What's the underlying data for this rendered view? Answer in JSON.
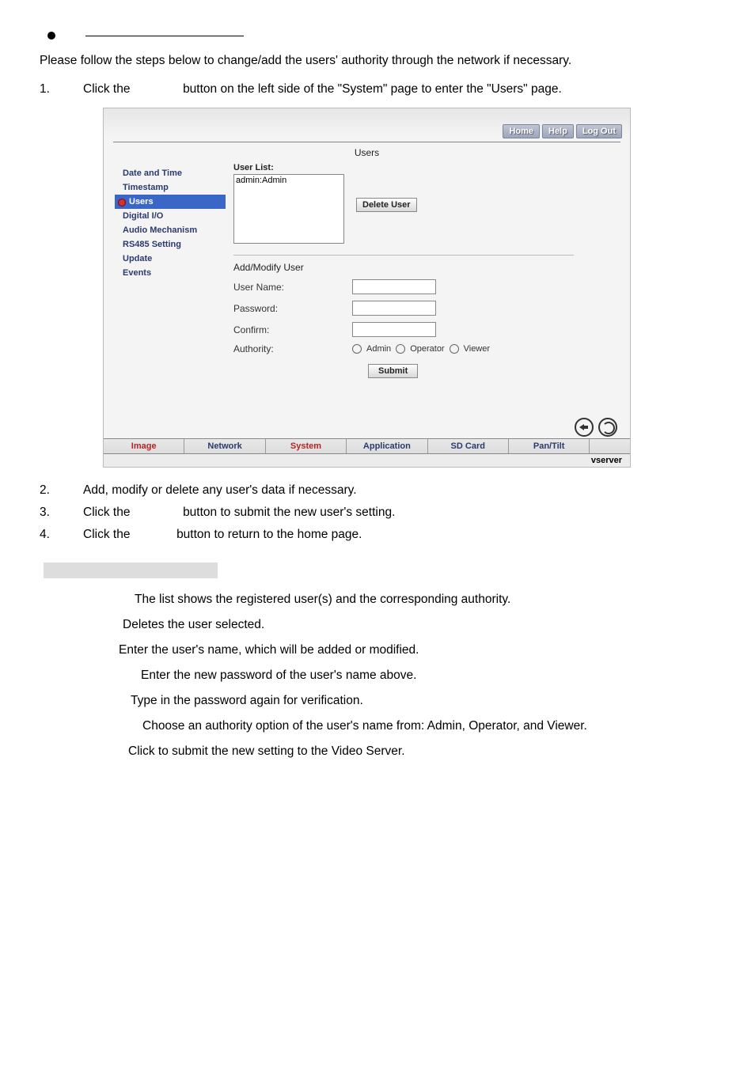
{
  "intro": "Please follow the steps below to change/add the users' authority through the network if necessary.",
  "steps": {
    "s1_a": "Click the",
    "s1_b": "button on the left side of the \"System\" page to enter the \"Users\" page.",
    "s2": "Add, modify or delete any user's data if necessary.",
    "s3_a": "Click the",
    "s3_b": "button to submit the new user's setting.",
    "s4_a": "Click the",
    "s4_b": "button to return to the home page."
  },
  "nums": {
    "n1": "1.",
    "n2": "2.",
    "n3": "3.",
    "n4": "4."
  },
  "ui": {
    "top": {
      "home": "Home",
      "help": "Help",
      "logout": "Log Out"
    },
    "title": "Users",
    "sidebar": {
      "date": "Date and Time",
      "timestamp": "Timestamp",
      "users": "Users",
      "digital": "Digital I/O",
      "audio": "Audio Mechanism",
      "rs485": "RS485 Setting",
      "update": "Update",
      "events": "Events"
    },
    "userlist_label": "User List:",
    "userlist_value": "admin:Admin",
    "delete_btn": "Delete User",
    "addmod": "Add/Modify User",
    "username_lbl": "User Name:",
    "password_lbl": "Password:",
    "confirm_lbl": "Confirm:",
    "authority_lbl": "Authority:",
    "auth": {
      "admin": "Admin",
      "operator": "Operator",
      "viewer": "Viewer"
    },
    "submit": "Submit",
    "tabs": {
      "image": "Image",
      "network": "Network",
      "system": "System",
      "application": "Application",
      "sdcard": "SD Card",
      "pantilt": "Pan/Tilt"
    },
    "footer": "vserver"
  },
  "desc": {
    "d1": "The list shows the registered user(s) and the corresponding authority.",
    "d2": "Deletes the user selected.",
    "d3": "Enter the user's name, which will be added or modified.",
    "d4": "Enter the new password of the user's name above.",
    "d5": "Type in the password again for verification.",
    "d6": "Choose an authority option of the user's name from: Admin, Operator, and Viewer.",
    "d7": "Click to submit the new setting to the Video Server."
  }
}
